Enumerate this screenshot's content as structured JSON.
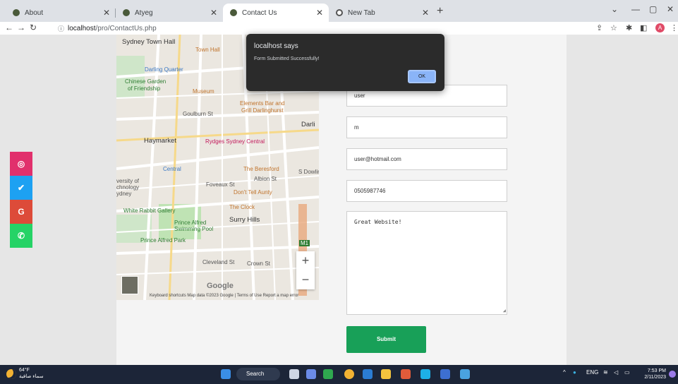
{
  "browser": {
    "tabs": [
      {
        "title": "About",
        "active": false
      },
      {
        "title": "Atyeg",
        "active": false
      },
      {
        "title": "Contact Us",
        "active": true
      },
      {
        "title": "New Tab",
        "active": false
      }
    ],
    "url_host": "localhost",
    "url_path": "/pro/ContactUs.php"
  },
  "map": {
    "labels": {
      "sydney_town_hall": "Sydney Town Hall",
      "town_hall": "Town Hall",
      "darling_quarter": "Darling Quarter",
      "chinese_garden": "Chinese Garden",
      "of_friendship": "of Friendship",
      "museum": "Museum",
      "elements_bar": "Elements Bar and",
      "grill": "Grill Darlinghurst",
      "goulburn": "Goulburn St",
      "darli": "Darli",
      "haymarket": "Haymarket",
      "rydges": "Rydges Sydney Central",
      "central": "Central",
      "beresford": "The Beresford",
      "albion": "Albion St",
      "versity": "versity of",
      "chnology": "chnology",
      "ydney": "ydney",
      "foveaux": "Foveaux St",
      "dont_tell": "Don't Tell Aunty",
      "dowling": "S Dowling St",
      "white_rabbit": "White Rabbit Gallery",
      "clock": "The Clock",
      "surry_hills": "Surry Hills",
      "prince_alfred_pool": "Prince Alfred",
      "swimming_pool": "Swimming Pool",
      "prince_alfred_park": "Prince Alfred Park",
      "cleveland": "Cleveland St",
      "crown": "Crown St",
      "m1": "M1",
      "google": "Google"
    },
    "footer": "Keyboard shortcuts   Map data ©2023 Google | Terms of Use   Report a map error"
  },
  "form": {
    "name_value": "user",
    "field2_value": "m",
    "email_value": "user@hotmail.com",
    "phone_value": "0505987746",
    "message_value": "Great Website!",
    "submit_label": "Submit"
  },
  "social": [
    {
      "name": "instagram",
      "glyph": "◎",
      "color": "#e1306c"
    },
    {
      "name": "twitter",
      "glyph": "✔",
      "color": "#1da1f2"
    },
    {
      "name": "google",
      "glyph": "G",
      "color": "#dd4b39"
    },
    {
      "name": "whatsapp",
      "glyph": "✆",
      "color": "#25d366"
    }
  ],
  "alert": {
    "title": "localhost says",
    "message": "Form Submitted Successfully!",
    "ok_label": "OK"
  },
  "taskbar": {
    "temperature": "64°F",
    "weather_text": "سماء صافية",
    "search_label": "Search",
    "language": "ENG",
    "time": "7:53 PM",
    "date": "2/11/2023"
  }
}
